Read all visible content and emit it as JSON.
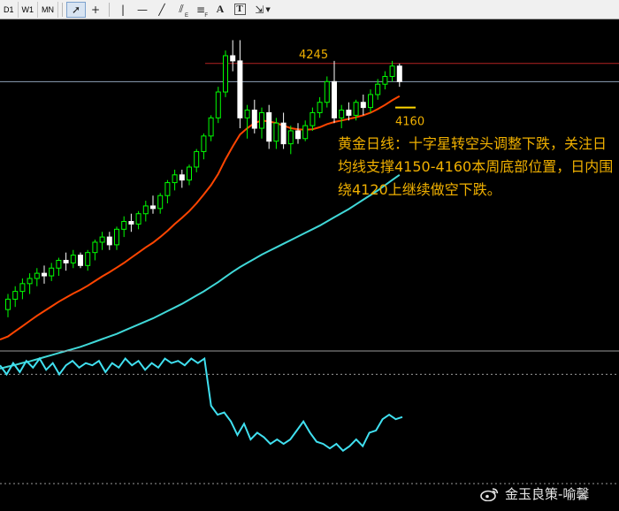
{
  "toolbar": {
    "timeframes": [
      "D1",
      "W1",
      "MN"
    ],
    "tools": [
      "cursor-icon",
      "crosshair-icon",
      "vertical-line-icon",
      "horizontal-line-icon",
      "trendline-icon",
      "fibonacci-icon",
      "text-icon",
      "text-label-icon",
      "arrows-menu-icon"
    ]
  },
  "colors": {
    "background": "#000000",
    "bull_candle": "#00ff00",
    "bear_candle": "#ffffff",
    "ma_short": "#ff4500",
    "ma_long": "#40d8d8",
    "resistance_line": "#b22222",
    "price_line": "#8fa3b8",
    "support_mark": "#ffd700",
    "annotation": "#f0b000",
    "oscillator": "#40e0f0"
  },
  "chart_data": [
    {
      "type": "candlestick",
      "levels": {
        "resistance": 4245,
        "support": 4160
      },
      "price_labels": [
        "4245",
        "4160"
      ],
      "price_range": [
        3690,
        4330
      ],
      "candles": [
        [
          3770,
          3800,
          3755,
          3790
        ],
        [
          3790,
          3815,
          3775,
          3805
        ],
        [
          3805,
          3830,
          3790,
          3820
        ],
        [
          3820,
          3840,
          3800,
          3830
        ],
        [
          3830,
          3850,
          3815,
          3840
        ],
        [
          3840,
          3855,
          3820,
          3835
        ],
        [
          3835,
          3860,
          3825,
          3850
        ],
        [
          3850,
          3870,
          3835,
          3865
        ],
        [
          3865,
          3880,
          3845,
          3860
        ],
        [
          3860,
          3885,
          3850,
          3875
        ],
        [
          3875,
          3880,
          3850,
          3855
        ],
        [
          3855,
          3885,
          3845,
          3880
        ],
        [
          3880,
          3905,
          3865,
          3900
        ],
        [
          3900,
          3920,
          3885,
          3910
        ],
        [
          3910,
          3920,
          3885,
          3895
        ],
        [
          3895,
          3930,
          3885,
          3925
        ],
        [
          3925,
          3950,
          3910,
          3940
        ],
        [
          3940,
          3955,
          3920,
          3935
        ],
        [
          3935,
          3960,
          3925,
          3955
        ],
        [
          3955,
          3980,
          3940,
          3970
        ],
        [
          3970,
          3990,
          3955,
          3965
        ],
        [
          3965,
          3995,
          3955,
          3990
        ],
        [
          3990,
          4020,
          3975,
          4015
        ],
        [
          4015,
          4040,
          4000,
          4030
        ],
        [
          4030,
          4040,
          4005,
          4020
        ],
        [
          4020,
          4050,
          4010,
          4045
        ],
        [
          4045,
          4080,
          4035,
          4075
        ],
        [
          4075,
          4110,
          4060,
          4105
        ],
        [
          4105,
          4145,
          4095,
          4140
        ],
        [
          4140,
          4200,
          4130,
          4190
        ],
        [
          4190,
          4270,
          4180,
          4260
        ],
        [
          4260,
          4290,
          4230,
          4250
        ],
        [
          4250,
          4290,
          4120,
          4140
        ],
        [
          4140,
          4165,
          4100,
          4155
        ],
        [
          4155,
          4175,
          4110,
          4120
        ],
        [
          4120,
          4160,
          4100,
          4150
        ],
        [
          4150,
          4165,
          4080,
          4095
        ],
        [
          4095,
          4140,
          4080,
          4130
        ],
        [
          4130,
          4150,
          4080,
          4090
        ],
        [
          4090,
          4125,
          4070,
          4115
        ],
        [
          4115,
          4130,
          4090,
          4100
        ],
        [
          4100,
          4135,
          4095,
          4125
        ],
        [
          4125,
          4160,
          4115,
          4150
        ],
        [
          4150,
          4180,
          4140,
          4170
        ],
        [
          4170,
          4220,
          4160,
          4210
        ],
        [
          4210,
          4250,
          4130,
          4140
        ],
        [
          4140,
          4165,
          4120,
          4155
        ],
        [
          4155,
          4170,
          4135,
          4145
        ],
        [
          4145,
          4175,
          4135,
          4170
        ],
        [
          4170,
          4185,
          4145,
          4160
        ],
        [
          4160,
          4195,
          4150,
          4185
        ],
        [
          4185,
          4215,
          4175,
          4205
        ],
        [
          4205,
          4230,
          4195,
          4220
        ],
        [
          4220,
          4250,
          4210,
          4240
        ],
        [
          4240,
          4245,
          4200,
          4210
        ]
      ],
      "ma_short": [
        3718,
        3728,
        3738,
        3748,
        3758,
        3767,
        3776,
        3785,
        3793,
        3801,
        3808,
        3816,
        3825,
        3834,
        3842,
        3851,
        3860,
        3870,
        3880,
        3890,
        3899,
        3910,
        3922,
        3935,
        3947,
        3960,
        3975,
        3992,
        4010,
        4032,
        4060,
        4085,
        4108,
        4120,
        4130,
        4135,
        4133,
        4130,
        4125,
        4120,
        4118,
        4117,
        4118,
        4122,
        4128,
        4132,
        4135,
        4138,
        4141,
        4145,
        4150,
        4157,
        4165,
        4174,
        4182
      ],
      "ma_long": [
        3660,
        3663,
        3667,
        3670,
        3674,
        3678,
        3682,
        3686,
        3690,
        3694,
        3698,
        3703,
        3708,
        3713,
        3718,
        3723,
        3729,
        3735,
        3741,
        3747,
        3753,
        3760,
        3767,
        3774,
        3781,
        3789,
        3797,
        3805,
        3814,
        3823,
        3833,
        3843,
        3852,
        3860,
        3868,
        3876,
        3883,
        3890,
        3897,
        3904,
        3911,
        3918,
        3925,
        3932,
        3940,
        3948,
        3956,
        3964,
        3973,
        3982,
        3991,
        4000,
        4010,
        4020,
        4030
      ]
    },
    {
      "type": "line",
      "name": "oscillator",
      "y_range": [
        0,
        100
      ],
      "reference_level": 80,
      "values": [
        88,
        80,
        90,
        82,
        92,
        86,
        94,
        84,
        90,
        80,
        88,
        92,
        86,
        90,
        88,
        92,
        82,
        90,
        86,
        94,
        88,
        92,
        84,
        90,
        86,
        94,
        90,
        92,
        88,
        94,
        90,
        94,
        52,
        44,
        46,
        38,
        26,
        36,
        22,
        28,
        24,
        18,
        22,
        18,
        22,
        30,
        38,
        28,
        20,
        18,
        14,
        18,
        12,
        16,
        22,
        16,
        28,
        30,
        40,
        44,
        40,
        42
      ]
    }
  ],
  "annotation": {
    "text": "黄金日线：十字星转空头调整下跌，关注日均线支撑4150-4160本周底部位置，日内围绕4120上继续做空下跌。"
  },
  "watermark": {
    "text": "金玉良策-喻馨"
  }
}
